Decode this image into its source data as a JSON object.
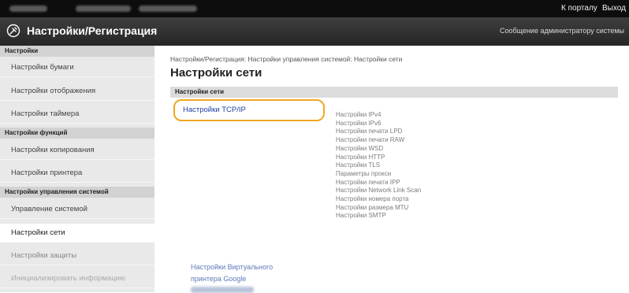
{
  "topbar": {
    "portal_link": "К порталу",
    "logout_link": "Выход"
  },
  "header": {
    "title": "Настройки/Регистрация",
    "admin_message": "Сообщение администратору системы"
  },
  "sidebar": {
    "groups": [
      {
        "heading": "Настройки",
        "items": [
          "Настройки бумаги",
          "Настройки отображения",
          "Настройки таймера"
        ]
      },
      {
        "heading": "Настройки функций",
        "items": [
          "Настройки копирования",
          "Настройки принтера"
        ]
      },
      {
        "heading": "Настройки управления системой",
        "items": [
          "Управление системой",
          "Настройки сети",
          "Настройки защиты",
          "Инициализировать информацию"
        ]
      }
    ],
    "active_item": "Настройки сети"
  },
  "main": {
    "breadcrumb": "Настройки/Регистрация: Настройки управления системой: Настройки сети",
    "page_title": "Настройки сети",
    "section_title": "Настройки сети",
    "tcpip_link": "Настройки TCP/IP",
    "tcpip_subitems": [
      "Настройки IPv4",
      "Настройки IPv6",
      "Настройки печати LPD",
      "Настройки печати RAW",
      "Настройки WSD",
      "Настройки HTTP",
      "Настройки TLS",
      "Параметры прокси",
      "Настройки печати IPP",
      "Настройки Network Link Scan",
      "Настройки номера порта",
      "Настройки размера MTU",
      "Настройки SMTP"
    ],
    "google_link_line1": "Настройки Виртуального",
    "google_link_line2": "принтера Google"
  },
  "colors": {
    "highlight": "#f0a623",
    "link": "#1d3fa8",
    "header_bg": "#2f2f2f"
  }
}
